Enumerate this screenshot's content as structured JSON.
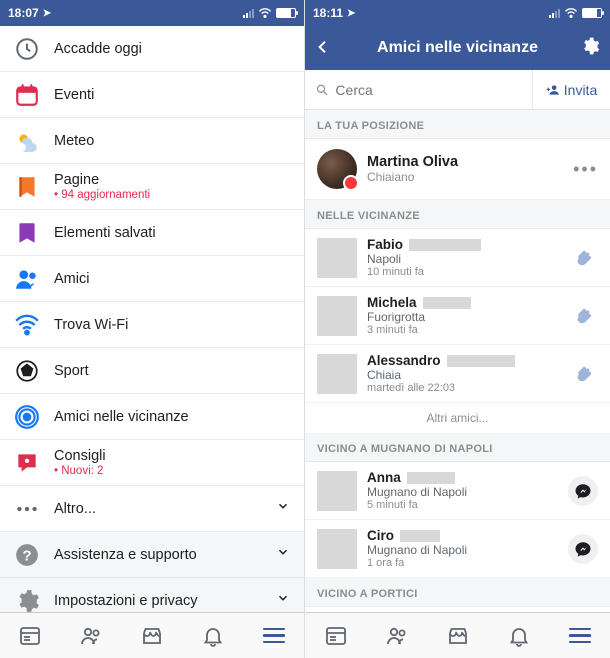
{
  "left": {
    "status_time": "18:07",
    "menu": [
      {
        "key": "today",
        "title": "Accadde oggi",
        "sub": ""
      },
      {
        "key": "events",
        "title": "Eventi",
        "sub": ""
      },
      {
        "key": "weather",
        "title": "Meteo",
        "sub": ""
      },
      {
        "key": "pages",
        "title": "Pagine",
        "sub": "• 94 aggiornamenti"
      },
      {
        "key": "saved",
        "title": "Elementi salvati",
        "sub": ""
      },
      {
        "key": "friends",
        "title": "Amici",
        "sub": ""
      },
      {
        "key": "wifi",
        "title": "Trova Wi-Fi",
        "sub": ""
      },
      {
        "key": "sport",
        "title": "Sport",
        "sub": ""
      },
      {
        "key": "nearby",
        "title": "Amici nelle vicinanze",
        "sub": ""
      },
      {
        "key": "tips",
        "title": "Consigli",
        "sub": "• Nuovi: 2"
      },
      {
        "key": "more",
        "title": "Altro...",
        "sub": "",
        "chev": true
      },
      {
        "key": "help",
        "title": "Assistenza e supporto",
        "sub": "",
        "chev": true,
        "section": true
      },
      {
        "key": "settings",
        "title": "Impostazioni e privacy",
        "sub": "",
        "chev": true,
        "section": true
      }
    ]
  },
  "right": {
    "status_time": "18:11",
    "header_title": "Amici nelle vicinanze",
    "search_placeholder": "Cerca",
    "invite_label": "Invita",
    "section_your_location": "LA TUA POSIZIONE",
    "me": {
      "name": "Martina Oliva",
      "location": "Chiaiano"
    },
    "section_nearby": "NELLE VICINANZE",
    "nearby": [
      {
        "name": "Fabio",
        "mask_w": 72,
        "location": "Napoli",
        "time": "10 minuti fa",
        "action": "wave"
      },
      {
        "name": "Michela",
        "mask_w": 48,
        "location": "Fuorigrotta",
        "time": "3 minuti fa",
        "action": "wave"
      },
      {
        "name": "Alessandro",
        "mask_w": 68,
        "location": "Chiaia",
        "time": "martedì alle 22:03",
        "action": "wave"
      }
    ],
    "more_friends": "Altri amici...",
    "section_mugnano": "VICINO A MUGNANO DI NAPOLI",
    "mugnano": [
      {
        "name": "Anna",
        "mask_w": 48,
        "location": "Mugnano di Napoli",
        "time": "5 minuti fa",
        "action": "msg"
      },
      {
        "name": "Ciro",
        "mask_w": 40,
        "location": "Mugnano di Napoli",
        "time": "1 ora fa",
        "action": "msg"
      }
    ],
    "section_portici": "VICINO A PORTICI"
  }
}
